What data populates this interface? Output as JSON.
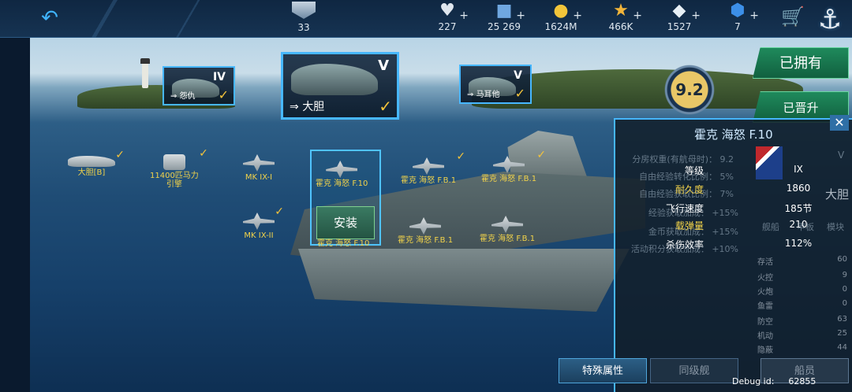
{
  "topbar": {
    "rank_value": "33",
    "resources": [
      {
        "icon": "heart-icon",
        "value": "227"
      },
      {
        "icon": "card-icon",
        "value": "25 269"
      },
      {
        "icon": "gold-coin-icon",
        "value": "1624M"
      },
      {
        "icon": "star-icon",
        "value": "466K"
      },
      {
        "icon": "diamond-icon",
        "value": "1527"
      },
      {
        "icon": "blue-gem-icon",
        "value": "7"
      }
    ]
  },
  "ships": [
    {
      "tier": "IV",
      "name": "怨仇"
    },
    {
      "tier": "V",
      "name": "大胆"
    },
    {
      "tier": "V",
      "name": "马耳他"
    }
  ],
  "equipment": [
    {
      "name": "大胆[B]"
    },
    {
      "name": "11400匹马力",
      "name2": "引擎"
    },
    {
      "name": "MK IX-I"
    },
    {
      "name": "MK IX-II"
    },
    {
      "name": "霍克 海怒 F.10"
    },
    {
      "name": "霍克 海怒 F.B.1"
    },
    {
      "name": "霍克 海怒 F.B.1"
    },
    {
      "name": "霍克 海怒 F.B.1"
    },
    {
      "name": "霍克 海怒 F.B.1"
    },
    {
      "name": "霍克 海怒 F.10"
    }
  ],
  "install_label": "安装",
  "rating": "9.2",
  "tabs": {
    "owned": "已拥有",
    "promoted": "已晋升"
  },
  "panel": {
    "title": "霍克 海怒 F.10",
    "stats": [
      {
        "label": "等级",
        "value": "IX"
      },
      {
        "label": "耐久度",
        "value": "1860"
      },
      {
        "label": "飞行速度",
        "value": "185节"
      },
      {
        "label": "载弹量",
        "value": "210"
      },
      {
        "label": "杀伤效率",
        "value": "112%"
      }
    ],
    "ghost": [
      "分房权重(有航母时)： 9.2",
      "自由经验转化比例： 5%",
      "自由经验获取比例： 7%",
      "经验获取加成： +15%",
      "金币获取加成： +15%",
      "活动积分获取加成： +10%"
    ]
  },
  "side": {
    "ship_name": "大胆",
    "tier": "V",
    "tabs": [
      "舰船",
      "甲板",
      "模块"
    ],
    "stats": [
      {
        "label": "存活",
        "value": "60"
      },
      {
        "label": "火控",
        "value": "9"
      },
      {
        "label": "火炮",
        "value": "0"
      },
      {
        "label": "鱼雷",
        "value": "0"
      },
      {
        "label": "防空",
        "value": "63"
      },
      {
        "label": "机动",
        "value": "25"
      },
      {
        "label": "隐蔽",
        "value": "44"
      }
    ],
    "crew_label": "船员"
  },
  "bottom": {
    "special": "特殊属性",
    "same_tier": "同级舰"
  },
  "debug": {
    "label": "Debug id:",
    "id": "62855"
  }
}
